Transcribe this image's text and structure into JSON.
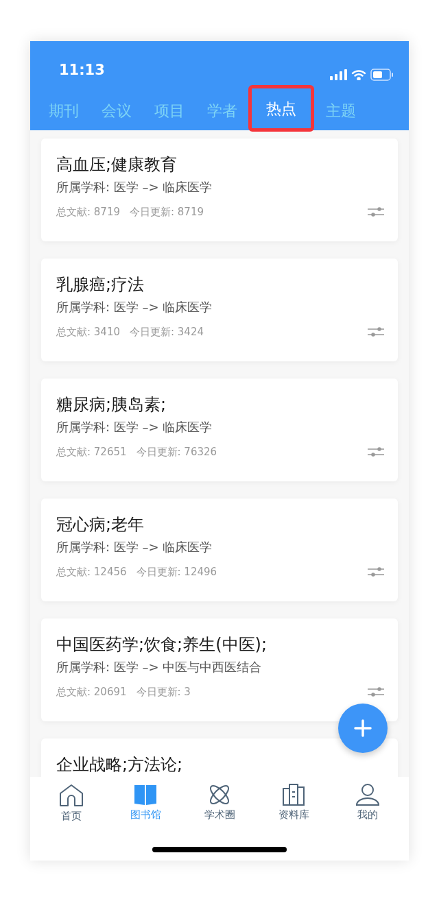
{
  "status_bar": {
    "time": "11:13"
  },
  "tabs": [
    {
      "label": "期刊",
      "selected": false
    },
    {
      "label": "会议",
      "selected": false
    },
    {
      "label": "项目",
      "selected": false
    },
    {
      "label": "学者",
      "selected": false
    },
    {
      "label": "热点",
      "selected": true
    },
    {
      "label": "主题",
      "selected": false
    }
  ],
  "topics": [
    {
      "title": "高血压;健康教育",
      "subject": "所属学科: 医学 –> 临床医学",
      "total": "总文献: 8719",
      "today": "今日更新: 8719"
    },
    {
      "title": "乳腺癌;疗法",
      "subject": "所属学科: 医学 –> 临床医学",
      "total": "总文献: 3410",
      "today": "今日更新: 3424"
    },
    {
      "title": "糖尿病;胰岛素;",
      "subject": "所属学科: 医学 –> 临床医学",
      "total": "总文献: 72651",
      "today": "今日更新: 76326"
    },
    {
      "title": "冠心病;老年",
      "subject": "所属学科: 医学 –> 临床医学",
      "total": "总文献: 12456",
      "today": "今日更新: 12496"
    },
    {
      "title": "中国医药学;饮食;养生(中医);",
      "subject": "所属学科: 医学 –> 中医与中西医结合",
      "total": "总文献: 20691",
      "today": "今日更新: 3"
    },
    {
      "title": "企业战略;方法论;"
    }
  ],
  "bottom_nav": [
    {
      "kind": "home",
      "label": "首页",
      "selected": false
    },
    {
      "kind": "library",
      "label": "图书馆",
      "selected": true
    },
    {
      "kind": "circle",
      "label": "学术圈",
      "selected": false
    },
    {
      "kind": "database",
      "label": "资料库",
      "selected": false
    },
    {
      "kind": "profile",
      "label": "我的",
      "selected": false
    }
  ]
}
